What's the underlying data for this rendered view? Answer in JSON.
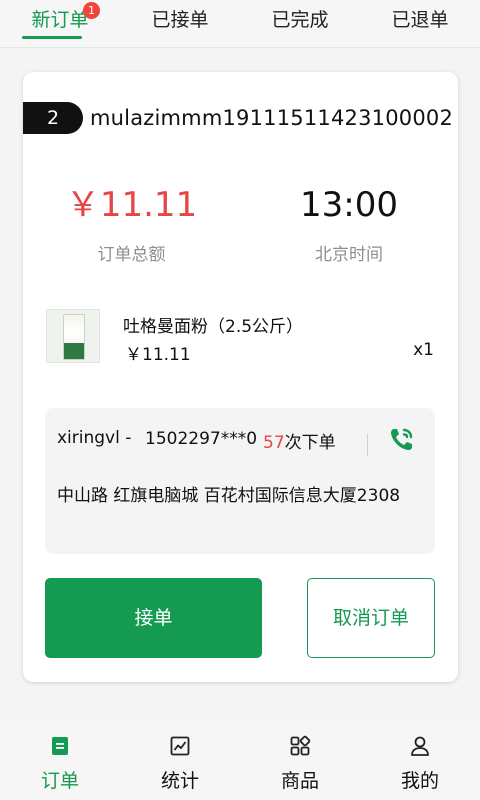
{
  "tabs": [
    {
      "label": "新订单",
      "badge": "1"
    },
    {
      "label": "已接单"
    },
    {
      "label": "已完成"
    },
    {
      "label": "已退单"
    }
  ],
  "order": {
    "sequence": "2",
    "order_number": "mulazimmm19111511423100002",
    "amount": "￥11.11",
    "amount_label": "订单总额",
    "time": "13:00",
    "time_label": "北京时间"
  },
  "product": {
    "image_icon": "flour-bag-image",
    "name": "吐格曼面粉（2.5公斤）",
    "price": "￥11.11",
    "quantity": "x1"
  },
  "customer": {
    "name": "xiringvl  -",
    "phone": "1502297***0",
    "order_count": "57",
    "order_count_suffix": "次下单",
    "address": "中山路 红旗电脑城 百花村国际信息大厦2308"
  },
  "actions": {
    "accept_label": "接单",
    "cancel_label": "取消订单"
  },
  "bottom_nav": [
    {
      "label": "订单",
      "icon": "order-list-icon"
    },
    {
      "label": "统计",
      "icon": "chart-icon"
    },
    {
      "label": "商品",
      "icon": "grid-icon"
    },
    {
      "label": "我的",
      "icon": "user-icon"
    }
  ],
  "colors": {
    "accent": "#149a51",
    "price_red": "#e64545",
    "badge_red": "#f0453c"
  }
}
